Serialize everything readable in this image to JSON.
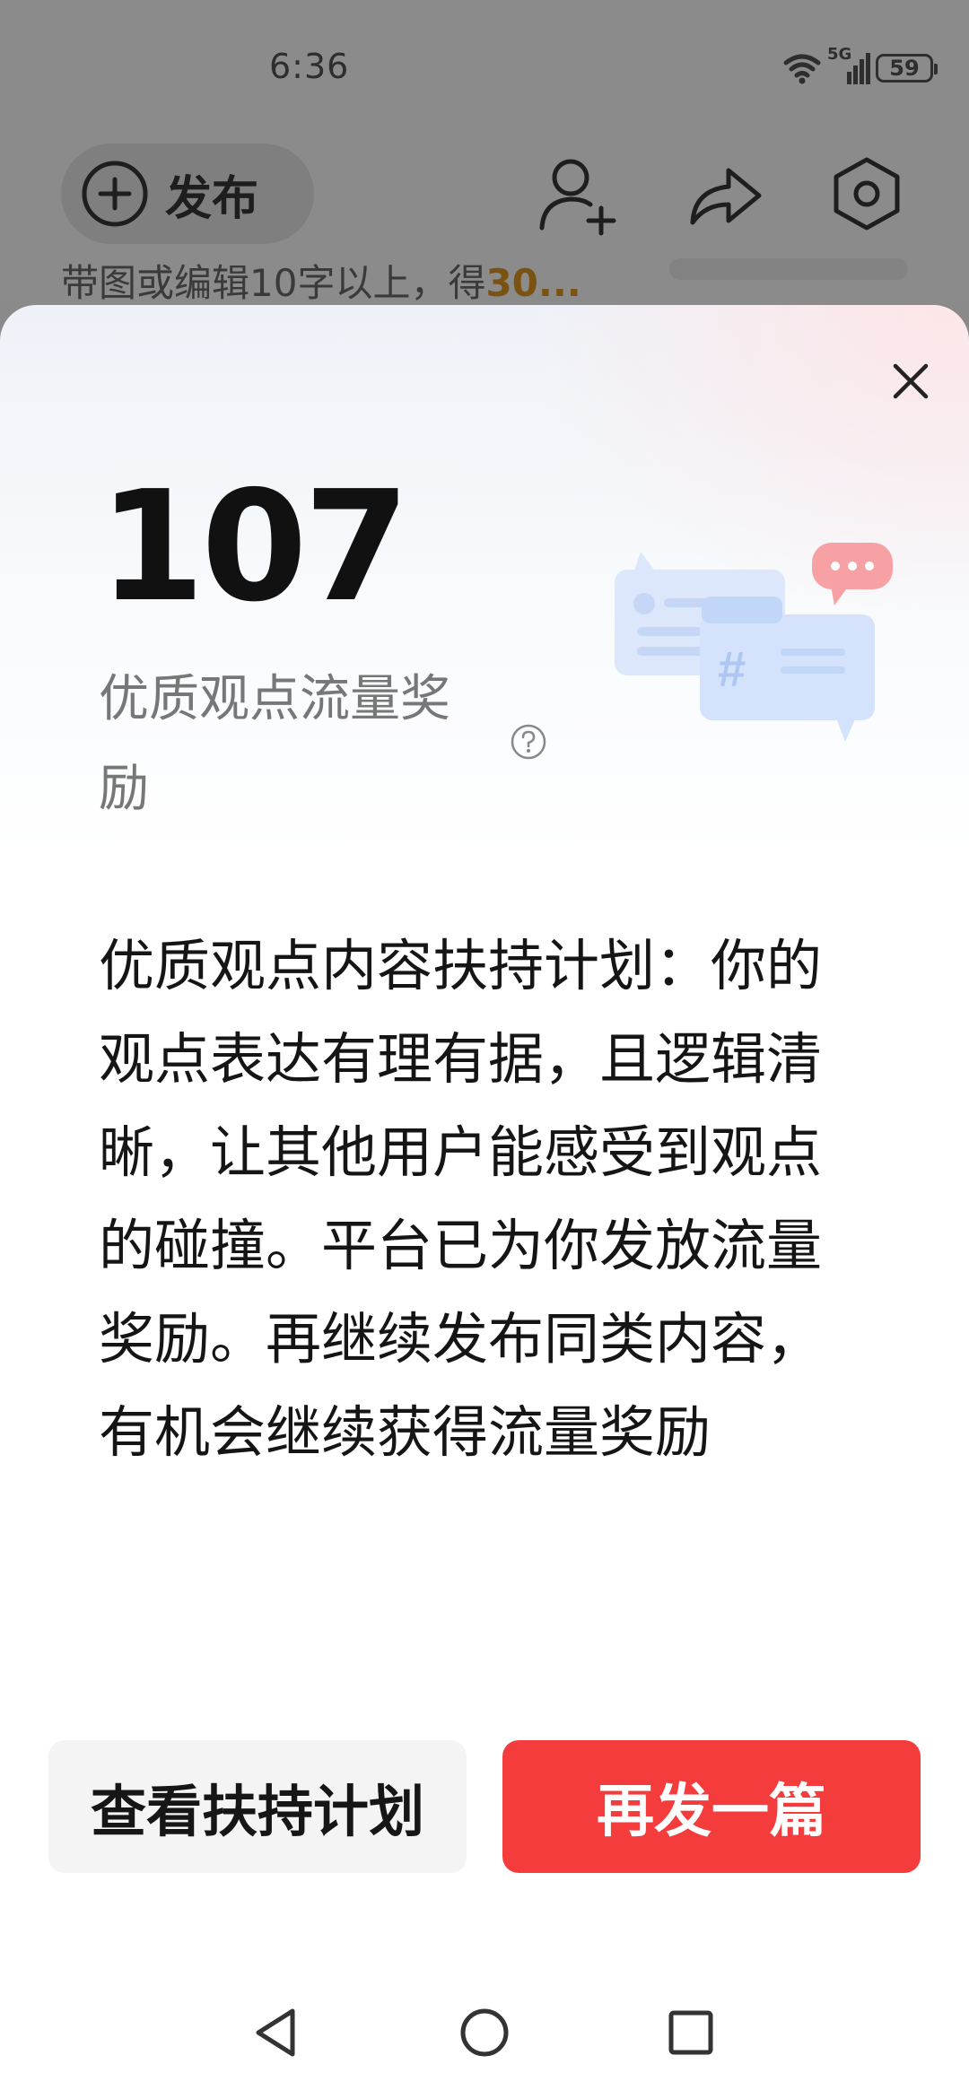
{
  "status_bar": {
    "time": "6:36",
    "network_type": "5G",
    "battery_level": "59",
    "icons": [
      "wifi-icon",
      "cellular-signal-icon",
      "battery-icon"
    ]
  },
  "header": {
    "publish_label": "发布",
    "icons": [
      "add-friend-icon",
      "share-icon",
      "settings-icon"
    ]
  },
  "hint": {
    "prefix": "带图或编辑10字以上，得",
    "highlight": "30..."
  },
  "sheet": {
    "reward_number": "107",
    "reward_label": "优质观点流量奖励",
    "description": "优质观点内容扶持计划：你的观点表达有理有据，且逻辑清晰，让其他用户能感受到观点的碰撞。平台已为你发放流量奖励。再继续发布同类内容，有机会继续获得流量奖励",
    "secondary_button_label": "查看扶持计划",
    "primary_button_label": "再发一篇",
    "illustration_hash": "#"
  },
  "nav_bar": {
    "icons": [
      "back-icon",
      "home-icon",
      "recents-icon"
    ]
  },
  "colors": {
    "primary_button": "#f53c3c",
    "secondary_button": "#f4f4f4",
    "hint_highlight": "#7a5212",
    "label_gray": "#777777"
  }
}
